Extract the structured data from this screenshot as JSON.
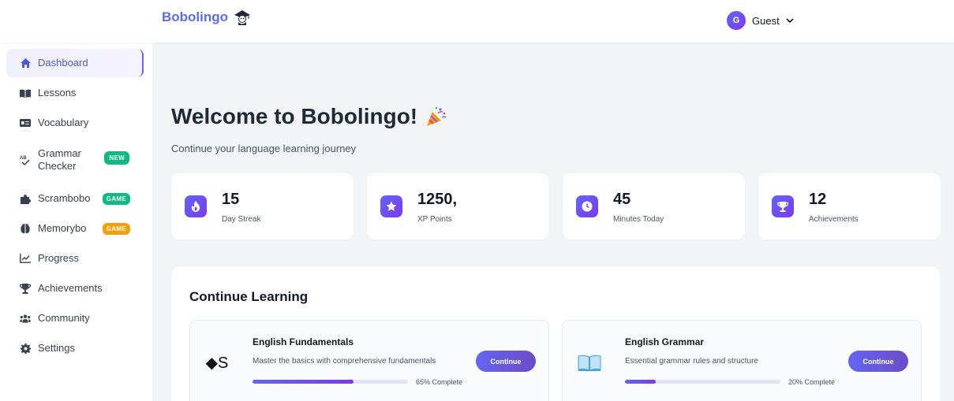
{
  "header": {
    "logo_text": "Bobolingo",
    "user_initial": "G",
    "user_name": "Guest"
  },
  "sidebar": {
    "items": [
      {
        "label": "Dashboard",
        "icon": "home-icon",
        "active": true
      },
      {
        "label": "Lessons",
        "icon": "book-icon"
      },
      {
        "label": "Vocabulary",
        "icon": "id-card-icon"
      },
      {
        "label": "Grammar Checker",
        "icon": "spellcheck-icon",
        "badge": "NEW"
      },
      {
        "label": "Scrambobo",
        "icon": "puzzle-icon",
        "badge": "GAME"
      },
      {
        "label": "Memorybo",
        "icon": "brain-icon",
        "badge": "GAME"
      },
      {
        "label": "Progress",
        "icon": "chart-line-icon"
      },
      {
        "label": "Achievements",
        "icon": "trophy-icon"
      },
      {
        "label": "Community",
        "icon": "users-icon"
      },
      {
        "label": "Settings",
        "icon": "gear-icon"
      }
    ]
  },
  "main": {
    "welcome": "Welcome to Bobolingo!",
    "subtitle": "Continue your language learning journey"
  },
  "stats": [
    {
      "value": "15",
      "label": "Day Streak",
      "icon": "fire-icon"
    },
    {
      "value": "1250,",
      "label": "XP Points",
      "icon": "star-icon"
    },
    {
      "value": "45",
      "label": "Minutes Today",
      "icon": "clock-icon"
    },
    {
      "value": "12",
      "label": "Achievements",
      "icon": "trophy-icon"
    }
  ],
  "learning": {
    "title": "Continue Learning",
    "courses": [
      {
        "title": "English Fundamentals",
        "description": "Master the basics with comprehensive fundamentals",
        "progress": 65,
        "progress_text": "65% Complete",
        "button": "Continue",
        "icon_text": "◆S"
      },
      {
        "title": "English Grammar",
        "description": "Essential grammar rules and structure",
        "progress": 20,
        "progress_text": "20% Complete",
        "button": "Continue",
        "icon_text": ""
      }
    ]
  },
  "colors": {
    "accent": "#6366f1",
    "accent_purple": "#7c3aed",
    "badge_green": "#10b981",
    "badge_orange": "#f59e0b",
    "logo_blue": "#5b6ee1"
  }
}
